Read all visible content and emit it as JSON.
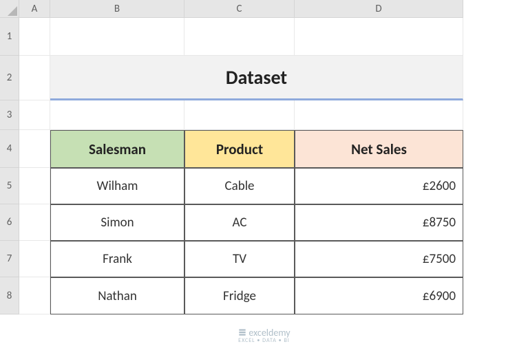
{
  "columns": {
    "corner": "",
    "A": "A",
    "B": "B",
    "C": "C",
    "D": "D"
  },
  "rows": {
    "r1": "1",
    "r2": "2",
    "r3": "3",
    "r4": "4",
    "r5": "5",
    "r6": "6",
    "r7": "7",
    "r8": "8"
  },
  "title": "Dataset",
  "headers": {
    "salesman": "Salesman",
    "product": "Product",
    "netsales": "Net Sales"
  },
  "data": [
    {
      "salesman": "Wilham",
      "product": "Cable",
      "netsales": "£2600"
    },
    {
      "salesman": "Simon",
      "product": "AC",
      "netsales": "£8750"
    },
    {
      "salesman": "Frank",
      "product": "TV",
      "netsales": "£7500"
    },
    {
      "salesman": "Nathan",
      "product": "Fridge",
      "netsales": "£6900"
    }
  ],
  "watermark": {
    "brand": "exceldemy",
    "tagline": "EXCEL • DATA • BI"
  }
}
